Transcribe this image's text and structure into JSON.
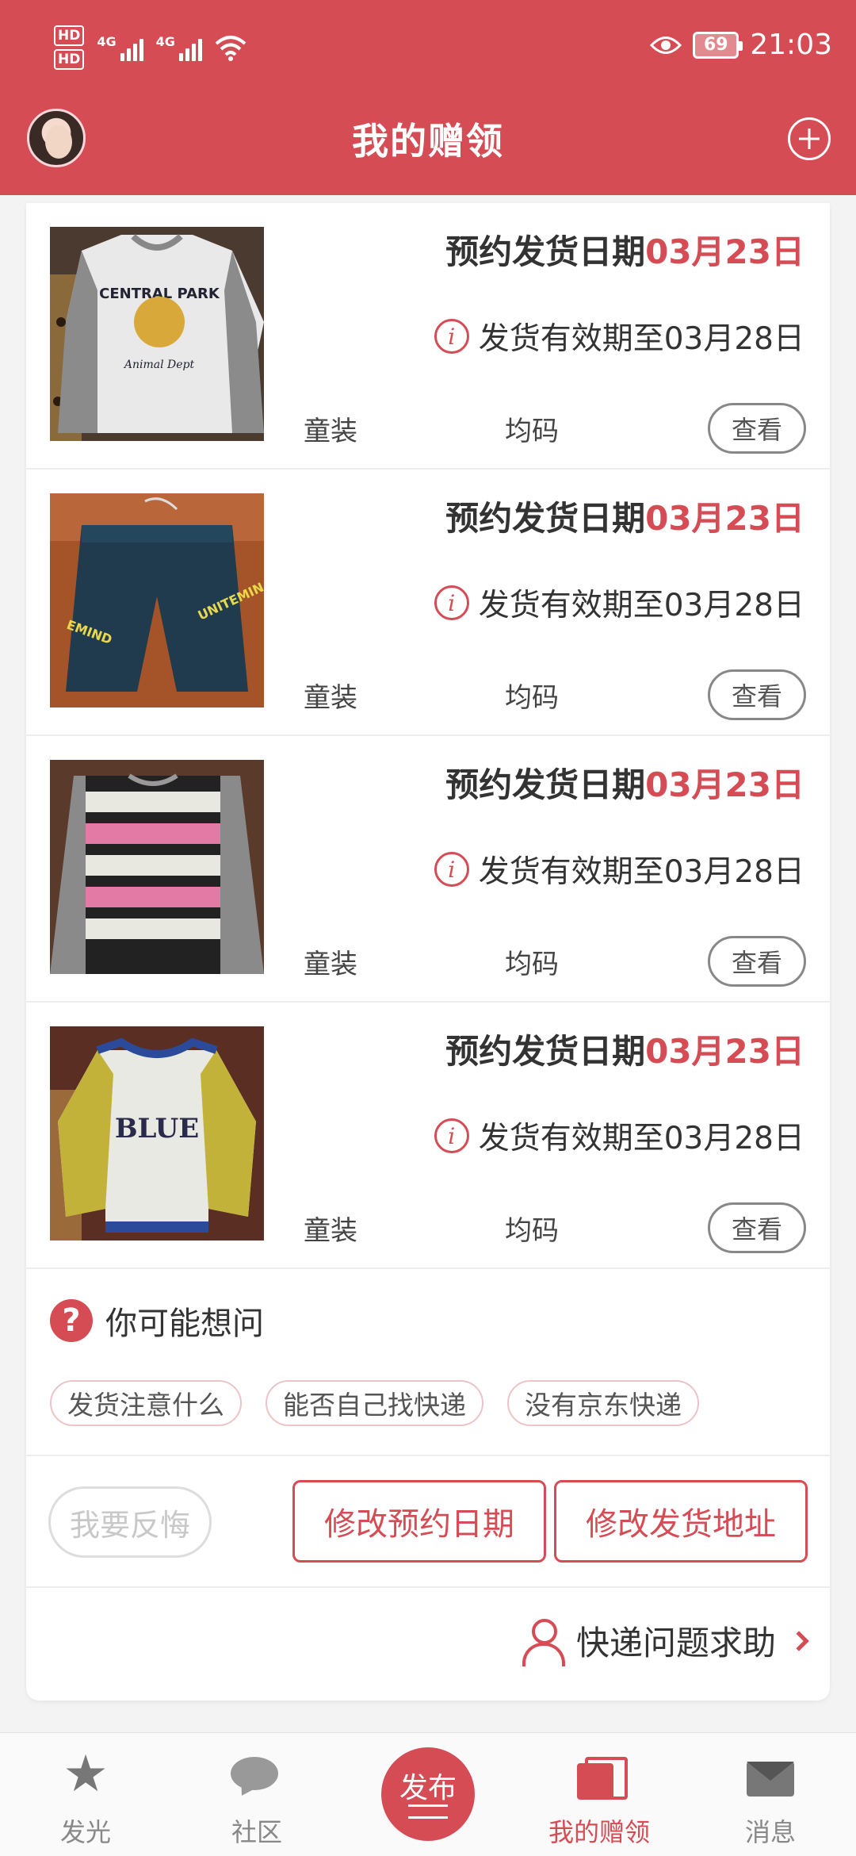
{
  "status_bar": {
    "hd1": "HD",
    "hd2": "HD",
    "net1": "4G",
    "net2": "4G",
    "battery": "69",
    "time": "21:03"
  },
  "header": {
    "title": "我的赠领"
  },
  "items": [
    {
      "date_label": "预约发货日期",
      "date_value": "03月23日",
      "valid_text": "发货有效期至03月28日",
      "category": "童装",
      "size": "均码",
      "view_label": "查看",
      "image": "gray-longsleeve-central-park-shirt"
    },
    {
      "date_label": "预约发货日期",
      "date_value": "03月23日",
      "valid_text": "发货有效期至03月28日",
      "category": "童装",
      "size": "均码",
      "view_label": "查看",
      "image": "dark-denim-shorts"
    },
    {
      "date_label": "预约发货日期",
      "date_value": "03月23日",
      "valid_text": "发货有效期至03月28日",
      "category": "童装",
      "size": "均码",
      "view_label": "查看",
      "image": "pink-pattern-sweater"
    },
    {
      "date_label": "预约发货日期",
      "date_value": "03月23日",
      "valid_text": "发货有效期至03月28日",
      "category": "童装",
      "size": "均码",
      "view_label": "查看",
      "image": "blue-yellow-raglan-shirt"
    }
  ],
  "faq": {
    "title": "你可能想问",
    "chips": [
      "发货注意什么",
      "能否自己找快递",
      "没有京东快递"
    ]
  },
  "actions": {
    "regret": "我要反悔",
    "change_date": "修改预约日期",
    "change_address": "修改发货地址"
  },
  "help": {
    "label": "快递问题求助"
  },
  "bottom_nav": {
    "items": [
      {
        "label": "发光",
        "icon": "star-icon"
      },
      {
        "label": "社区",
        "icon": "chat-icon"
      },
      {
        "label": "发布",
        "icon": "publish-icon"
      },
      {
        "label": "我的赠领",
        "icon": "book-icon",
        "active": true
      },
      {
        "label": "消息",
        "icon": "mail-icon"
      }
    ]
  },
  "colors": {
    "brand": "#d54c55",
    "background": "#f3f3f3"
  }
}
